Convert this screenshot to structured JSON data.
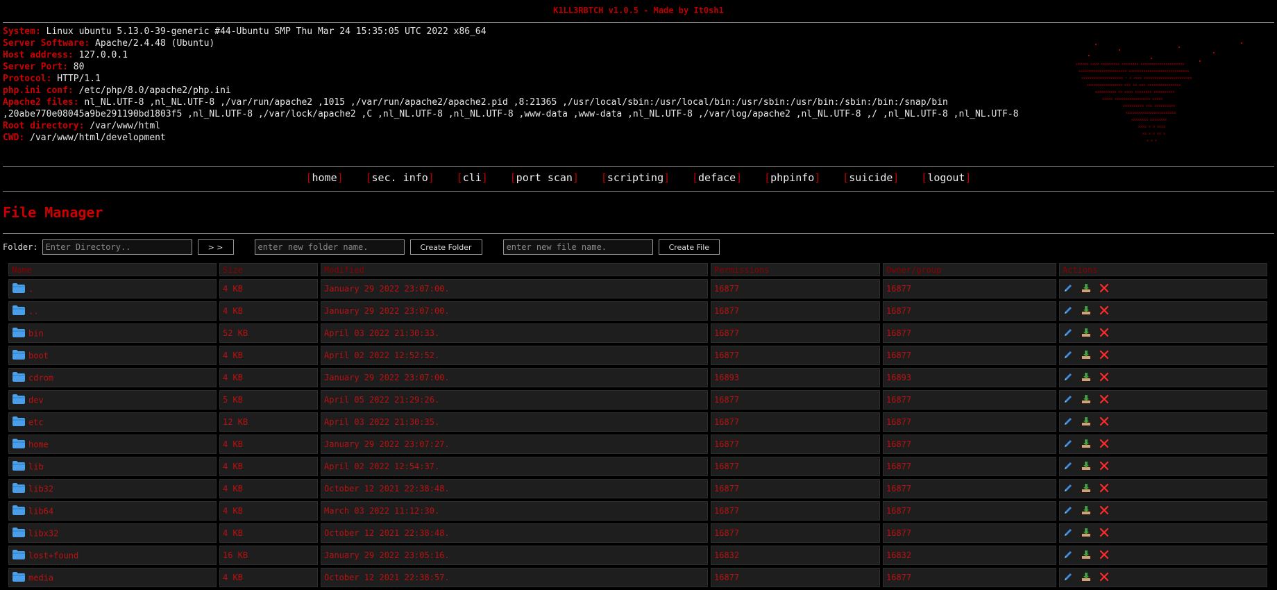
{
  "header": {
    "banner": "K1LL3RBTCH v1.0.5 - Made by It0sh1"
  },
  "info": {
    "system_label": "System:",
    "system": "Linux ubuntu 5.13.0-39-generic #44-Ubuntu SMP Thu Mar 24 15:35:05 UTC 2022 x86_64",
    "server_software_label": "Server Software:",
    "server_software": "Apache/2.4.48 (Ubuntu)",
    "host_label": "Host address:",
    "host": "127.0.0.1",
    "port_label": "Server Port:",
    "port": "80",
    "protocol_label": "Protocol:",
    "protocol": "HTTP/1.1",
    "phpini_label": "php.ini conf:",
    "phpini": "/etc/php/8.0/apache2/php.ini",
    "apache_files_label": "Apache2 files:",
    "apache_files": "nl_NL.UTF-8 ,nl_NL.UTF-8 ,/var/run/apache2 ,1015 ,/var/run/apache2/apache2.pid ,8:21365 ,/usr/local/sbin:/usr/local/bin:/usr/sbin:/usr/bin:/sbin:/bin:/snap/bin ,20abe770e08045a9be291190bd1803f5 ,nl_NL.UTF-8 ,/var/lock/apache2 ,C ,nl_NL.UTF-8 ,nl_NL.UTF-8 ,www-data ,www-data ,nl_NL.UTF-8 ,/var/log/apache2 ,nl_NL.UTF-8 ,/ ,nl_NL.UTF-8 ,nl_NL.UTF-8",
    "root_dir_label": "Root directory:",
    "root_dir": "/var/www/html",
    "cwd_label": "CWD:",
    "cwd": "/var/www/html/development"
  },
  "menu": {
    "items": [
      "home",
      "sec. info",
      "cli",
      "port scan",
      "scripting",
      "deface",
      "phpinfo",
      "suicide",
      "logout"
    ]
  },
  "file_manager": {
    "title": "File Manager",
    "folder_label": "Folder:",
    "directory_placeholder": "Enter Directory..",
    "go_button": "> >",
    "new_folder_placeholder": "enter new folder name.",
    "create_folder_button": "Create Folder",
    "new_file_placeholder": "enter new file name.",
    "create_file_button": "Create File",
    "columns": [
      "Name",
      "Size",
      "Modified",
      "Permissions",
      "Owner/group",
      "Actions"
    ],
    "rows": [
      {
        "name": ".",
        "size": "4 KB",
        "modified": "January 29 2022 23:07:00.",
        "perms": "16877",
        "owner": "16877"
      },
      {
        "name": "..",
        "size": "4 KB",
        "modified": "January 29 2022 23:07:00.",
        "perms": "16877",
        "owner": "16877"
      },
      {
        "name": "bin",
        "size": "52 KB",
        "modified": "April 03 2022 21:30:33.",
        "perms": "16877",
        "owner": "16877"
      },
      {
        "name": "boot",
        "size": "4 KB",
        "modified": "April 02 2022 12:52:52.",
        "perms": "16877",
        "owner": "16877"
      },
      {
        "name": "cdrom",
        "size": "4 KB",
        "modified": "January 29 2022 23:07:00.",
        "perms": "16893",
        "owner": "16893"
      },
      {
        "name": "dev",
        "size": "5 KB",
        "modified": "April 05 2022 21:29:26.",
        "perms": "16877",
        "owner": "16877"
      },
      {
        "name": "etc",
        "size": "12 KB",
        "modified": "April 03 2022 21:30:35.",
        "perms": "16877",
        "owner": "16877"
      },
      {
        "name": "home",
        "size": "4 KB",
        "modified": "January 29 2022 23:07:27.",
        "perms": "16877",
        "owner": "16877"
      },
      {
        "name": "lib",
        "size": "4 KB",
        "modified": "April 02 2022 12:54:37.",
        "perms": "16877",
        "owner": "16877"
      },
      {
        "name": "lib32",
        "size": "4 KB",
        "modified": "October 12 2021 22:38:48.",
        "perms": "16877",
        "owner": "16877"
      },
      {
        "name": "lib64",
        "size": "4 KB",
        "modified": "March 03 2022 11:12:30.",
        "perms": "16877",
        "owner": "16877"
      },
      {
        "name": "libx32",
        "size": "4 KB",
        "modified": "October 12 2021 22:38:48.",
        "perms": "16877",
        "owner": "16877"
      },
      {
        "name": "lost+found",
        "size": "16 KB",
        "modified": "January 29 2022 23:05:16.",
        "perms": "16832",
        "owner": "16832"
      },
      {
        "name": "media",
        "size": "4 KB",
        "modified": "October 12 2021 22:38:57.",
        "perms": "16877",
        "owner": "16877"
      }
    ]
  },
  "icons": {
    "folder": "folder-icon",
    "edit": "pencil-icon",
    "download": "download-icon",
    "delete": "delete-x-icon"
  },
  "colors": {
    "accent": "#cc0000",
    "folder": "#4a9fe8",
    "edit": "#3d8de0",
    "download": "#d9a070",
    "delete": "#ff2a2a"
  }
}
